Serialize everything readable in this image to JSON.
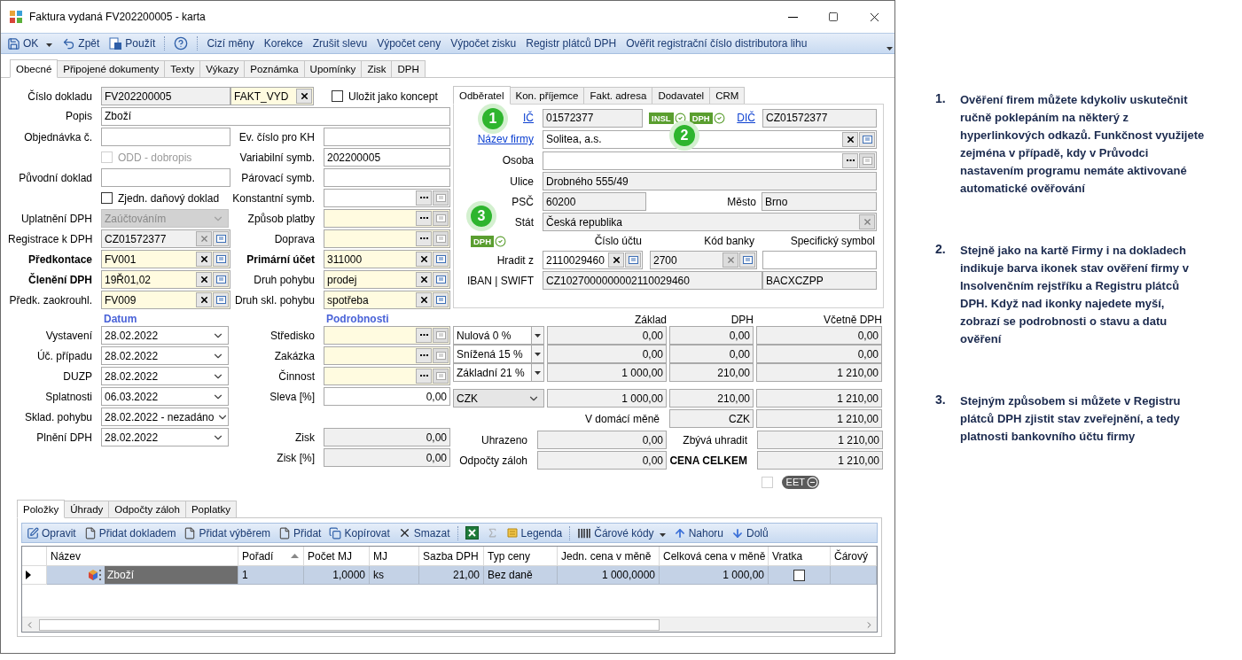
{
  "window": {
    "title": "Faktura vydaná FV202200005 - karta"
  },
  "toolbar": {
    "buttons": [
      {
        "kind": "save",
        "label": "OK",
        "menu": true
      },
      {
        "kind": "undo",
        "label": "Zpět",
        "menu": false
      },
      {
        "kind": "apply",
        "label": "Použít",
        "menu": false
      },
      {
        "kind": "help",
        "menu": false
      }
    ],
    "commands": [
      "Cizí měny",
      "Korekce",
      "Zrušit slevu",
      "Výpočet ceny",
      "Výpočet zisku",
      "Registr plátců DPH",
      "Ověřit registrační číslo distributora lihu"
    ]
  },
  "tabs": [
    {
      "label": "Obecné",
      "selected": true
    },
    {
      "label": "Připojené dokumenty",
      "selected": false
    },
    {
      "label": "Texty",
      "selected": false
    },
    {
      "label": "Výkazy",
      "selected": false
    },
    {
      "label": "Poznámka",
      "selected": false
    },
    {
      "label": "Upomínky",
      "selected": false
    },
    {
      "label": "Zisk",
      "selected": false
    },
    {
      "label": "DPH",
      "selected": false
    }
  ],
  "form": {
    "rows": [
      {
        "left": {
          "kind": "readonly",
          "label": "Číslo dokladu",
          "value": "FV202200005"
        },
        "right": {
          "kind": "series",
          "value": "FAKT_VYD",
          "check_label": "Uložit jako koncept",
          "checked": false
        }
      },
      {
        "left": {
          "kind": "wide",
          "label": "Popis",
          "value": "Zboží"
        }
      },
      {
        "left": {
          "kind": "text",
          "label": "Objednávka č."
        },
        "right": {
          "kind": "text",
          "label": "Ev. číslo pro KH"
        }
      },
      {
        "left": {
          "kind": "checkbox",
          "check_label": "ODD - dobropis",
          "checked": false,
          "disabled": true
        },
        "right": {
          "kind": "text",
          "label": "Variabilní symb.",
          "value": "202200005"
        }
      },
      {
        "left": {
          "kind": "text",
          "label": "Původní doklad"
        },
        "right": {
          "kind": "text",
          "label": "Párovací symb."
        }
      },
      {
        "left": {
          "kind": "checkbox",
          "check_label": "Zjedn. daňový doklad",
          "checked": false,
          "disabled": false
        },
        "right": {
          "kind": "picker_white",
          "label": "Konstantní symb."
        }
      },
      {
        "left": {
          "kind": "combo",
          "label": "Uplatnění DPH",
          "value": "Zaúčtováním",
          "disabled": true
        },
        "right": {
          "kind": "picker",
          "label": "Způsob platby"
        }
      },
      {
        "left": {
          "kind": "lookup_ro",
          "label": "Registrace k DPH",
          "value": "CZ01572377"
        },
        "right": {
          "kind": "picker",
          "label": "Doprava"
        }
      },
      {
        "left": {
          "kind": "lookup",
          "label": "Předkontace",
          "value": "FV001",
          "bold": true
        },
        "right": {
          "kind": "lookup",
          "label": "Primární účet",
          "value": "311000",
          "bold": true
        }
      },
      {
        "left": {
          "kind": "lookup",
          "label": "Členění DPH",
          "value": "19Ř01,02",
          "bold": true
        },
        "right": {
          "kind": "lookup",
          "label": "Druh pohybu",
          "value": "prodej"
        }
      },
      {
        "left": {
          "kind": "lookup",
          "label": "Předk. zaokrouhl.",
          "value": "FV009"
        },
        "right": {
          "kind": "lookup",
          "label": "Druh skl. pohybu",
          "value": "spotřeba"
        }
      },
      {
        "left": {
          "kind": "heading",
          "text": "Datum"
        },
        "right": {
          "kind": "heading",
          "text": "Podrobnosti"
        }
      },
      {
        "left": {
          "kind": "date",
          "label": "Vystavení",
          "value": "28.02.2022"
        },
        "right": {
          "kind": "picker",
          "label": "Středisko"
        }
      },
      {
        "left": {
          "kind": "date",
          "label": "Úč. případu",
          "value": "28.02.2022"
        },
        "right": {
          "kind": "picker",
          "label": "Zakázka"
        }
      },
      {
        "left": {
          "kind": "date",
          "label": "DUZP",
          "value": "28.02.2022"
        },
        "right": {
          "kind": "picker",
          "label": "Činnost"
        }
      },
      {
        "left": {
          "kind": "date",
          "label": "Splatnosti",
          "value": "06.03.2022"
        },
        "right": {
          "kind": "number",
          "label": "Sleva [%]",
          "value": "0,00"
        }
      },
      {
        "left": {
          "kind": "date",
          "label": "Sklad. pohybu",
          "value": "28.02.2022 - nezadáno"
        }
      },
      {
        "left": {
          "kind": "date",
          "label": "Plnění DPH",
          "value": "28.02.2022"
        },
        "right": {
          "kind": "number_ro",
          "label": "Zisk",
          "value": "0,00"
        }
      },
      {
        "right": {
          "kind": "number_ro",
          "label": "Zisk [%]",
          "value": "0,00"
        }
      }
    ]
  },
  "customer_tabs": [
    {
      "label": "Odběratel",
      "selected": true
    },
    {
      "label": "Kon. příjemce",
      "selected": false
    },
    {
      "label": "Fakt. adresa",
      "selected": false
    },
    {
      "label": "Dodavatel",
      "selected": false
    },
    {
      "label": "CRM",
      "selected": false
    }
  ],
  "customer": {
    "ic": {
      "label": "IČ",
      "value": "01572377"
    },
    "badges": [
      {
        "label": "INSL",
        "verified": true
      },
      {
        "label": "DPH",
        "verified": true
      }
    ],
    "dic": {
      "label": "DIČ",
      "value": "CZ01572377"
    },
    "name": {
      "label": "Název firmy",
      "value": "Solitea, a.s."
    },
    "person": {
      "label": "Osoba"
    },
    "street": {
      "label": "Ulice",
      "value": "Drobného 555/49"
    },
    "zip": {
      "label": "PSČ",
      "value": "60200"
    },
    "city": {
      "label": "Město",
      "value": "Brno"
    },
    "country": {
      "label": "Stát",
      "value": "Česká republika"
    },
    "bank_badge": {
      "label": "DPH",
      "verified": true
    },
    "bank_headers": [
      "Číslo účtu",
      "Kód banky",
      "Specifický symbol"
    ],
    "pay_from": {
      "label": "Hradit z",
      "account": "2110029460",
      "bank_code": "2700"
    },
    "iban": {
      "label": "IBAN | SWIFT",
      "iban": "CZ1027000000002110029460",
      "swift": "BACXCZPP"
    }
  },
  "markers": [
    {
      "label": "1"
    },
    {
      "label": "2"
    },
    {
      "label": "3"
    }
  ],
  "totals": {
    "headers": [
      "Základ",
      "DPH",
      "Včetně DPH"
    ],
    "rates": [
      {
        "label": "Nulová 0 %",
        "base": "0,00",
        "vat": "0,00",
        "total": "0,00"
      },
      {
        "label": "Snížená 15 %",
        "base": "0,00",
        "vat": "0,00",
        "total": "0,00"
      },
      {
        "label": "Základní 21 %",
        "base": "1 000,00",
        "vat": "210,00",
        "total": "1 210,00"
      }
    ],
    "currency": {
      "value": "CZK",
      "base": "1 000,00",
      "vat": "210,00",
      "total": "1 210,00"
    },
    "domestic": {
      "label": "V domácí měně",
      "currency": "CZK",
      "total": "1 210,00"
    },
    "paid": {
      "label": "Uhrazeno",
      "value": "0,00"
    },
    "remaining": {
      "label": "Zbývá uhradit",
      "value": "1 210,00"
    },
    "advances": {
      "label": "Odpočty záloh",
      "value": "0,00"
    },
    "grand_total": {
      "label": "CENA CELKEM",
      "value": "1 210,00"
    }
  },
  "eet": {
    "label": "EET",
    "checked": false
  },
  "items_tabs": [
    {
      "label": "Položky",
      "selected": true
    },
    {
      "label": "Úhrady",
      "selected": false
    },
    {
      "label": "Odpočty záloh",
      "selected": false
    },
    {
      "label": "Poplatky",
      "selected": false
    }
  ],
  "items_toolbar": [
    {
      "kind": "edit",
      "label": "Opravit",
      "disabled": false
    },
    {
      "kind": "document",
      "label": "Přidat dokladem",
      "disabled": false
    },
    {
      "kind": "document",
      "label": "Přidat výběrem",
      "disabled": false
    },
    {
      "kind": "document",
      "label": "Přidat",
      "disabled": false
    },
    {
      "kind": "copy",
      "label": "Kopírovat",
      "disabled": false
    },
    {
      "kind": "delete",
      "label": "Smazat",
      "disabled": false
    },
    {
      "kind": "excel",
      "disabled": false
    },
    {
      "kind": "sum",
      "disabled": true
    },
    {
      "kind": "legend",
      "label": "Legenda",
      "disabled": false
    },
    {
      "kind": "barcode",
      "label": "Čárové kódy",
      "menu": true,
      "disabled": false
    },
    {
      "kind": "up",
      "label": "Nahoru",
      "disabled": false
    },
    {
      "kind": "down",
      "label": "Dolů",
      "disabled": false
    }
  ],
  "table": {
    "columns": [
      {
        "label": "Název",
        "sorted": false
      },
      {
        "label": "Pořadí",
        "sorted": true
      },
      {
        "label": "Počet MJ",
        "sorted": false
      },
      {
        "label": "MJ",
        "sorted": false
      },
      {
        "label": "Sazba DPH",
        "sorted": false
      },
      {
        "label": "Typ ceny",
        "sorted": false
      },
      {
        "label": "Jedn. cena v měně",
        "sorted": false
      },
      {
        "label": "Celková cena v měně",
        "sorted": false
      },
      {
        "label": "Vratka",
        "sorted": false
      },
      {
        "label": "Čárový",
        "sorted": false
      }
    ],
    "rows": [
      {
        "selected": true,
        "returned": false,
        "cells": [
          {
            "text": "Zboží",
            "focused": true
          },
          {
            "text": "1",
            "focused": false
          },
          {
            "text": "1,0000",
            "focused": false
          },
          {
            "text": "ks",
            "focused": false
          },
          {
            "text": "21,00",
            "focused": false
          },
          {
            "text": "Bez daně",
            "focused": false
          },
          {
            "text": "1 000,0000",
            "focused": false
          },
          {
            "text": "1 000,00",
            "focused": false
          }
        ]
      }
    ]
  },
  "notes": [
    {
      "number": "1.",
      "text": "Ověření firem můžete kdykoliv uskutečnit ručně poklepáním na některý z hyperlinkových odkazů. Funkčnost využijete zejména v případě, kdy v Průvodci nastavením programu nemáte aktivované automatické ověřování"
    },
    {
      "number": "2.",
      "text": "Stejně jako na kartě Firmy i na dokladech indikuje barva ikonek stav ověření firmy v Insolvenčním rejstříku a Registru plátců DPH. Když nad ikonky najedete myší, zobrazí se podrobnosti o stavu a datu ověření"
    },
    {
      "number": "3.",
      "text": "Stejným způsobem si můžete v Registru plátců DPH zjistit stav zveřejnění, a tedy platnosti bankovního účtu firmy"
    }
  ]
}
